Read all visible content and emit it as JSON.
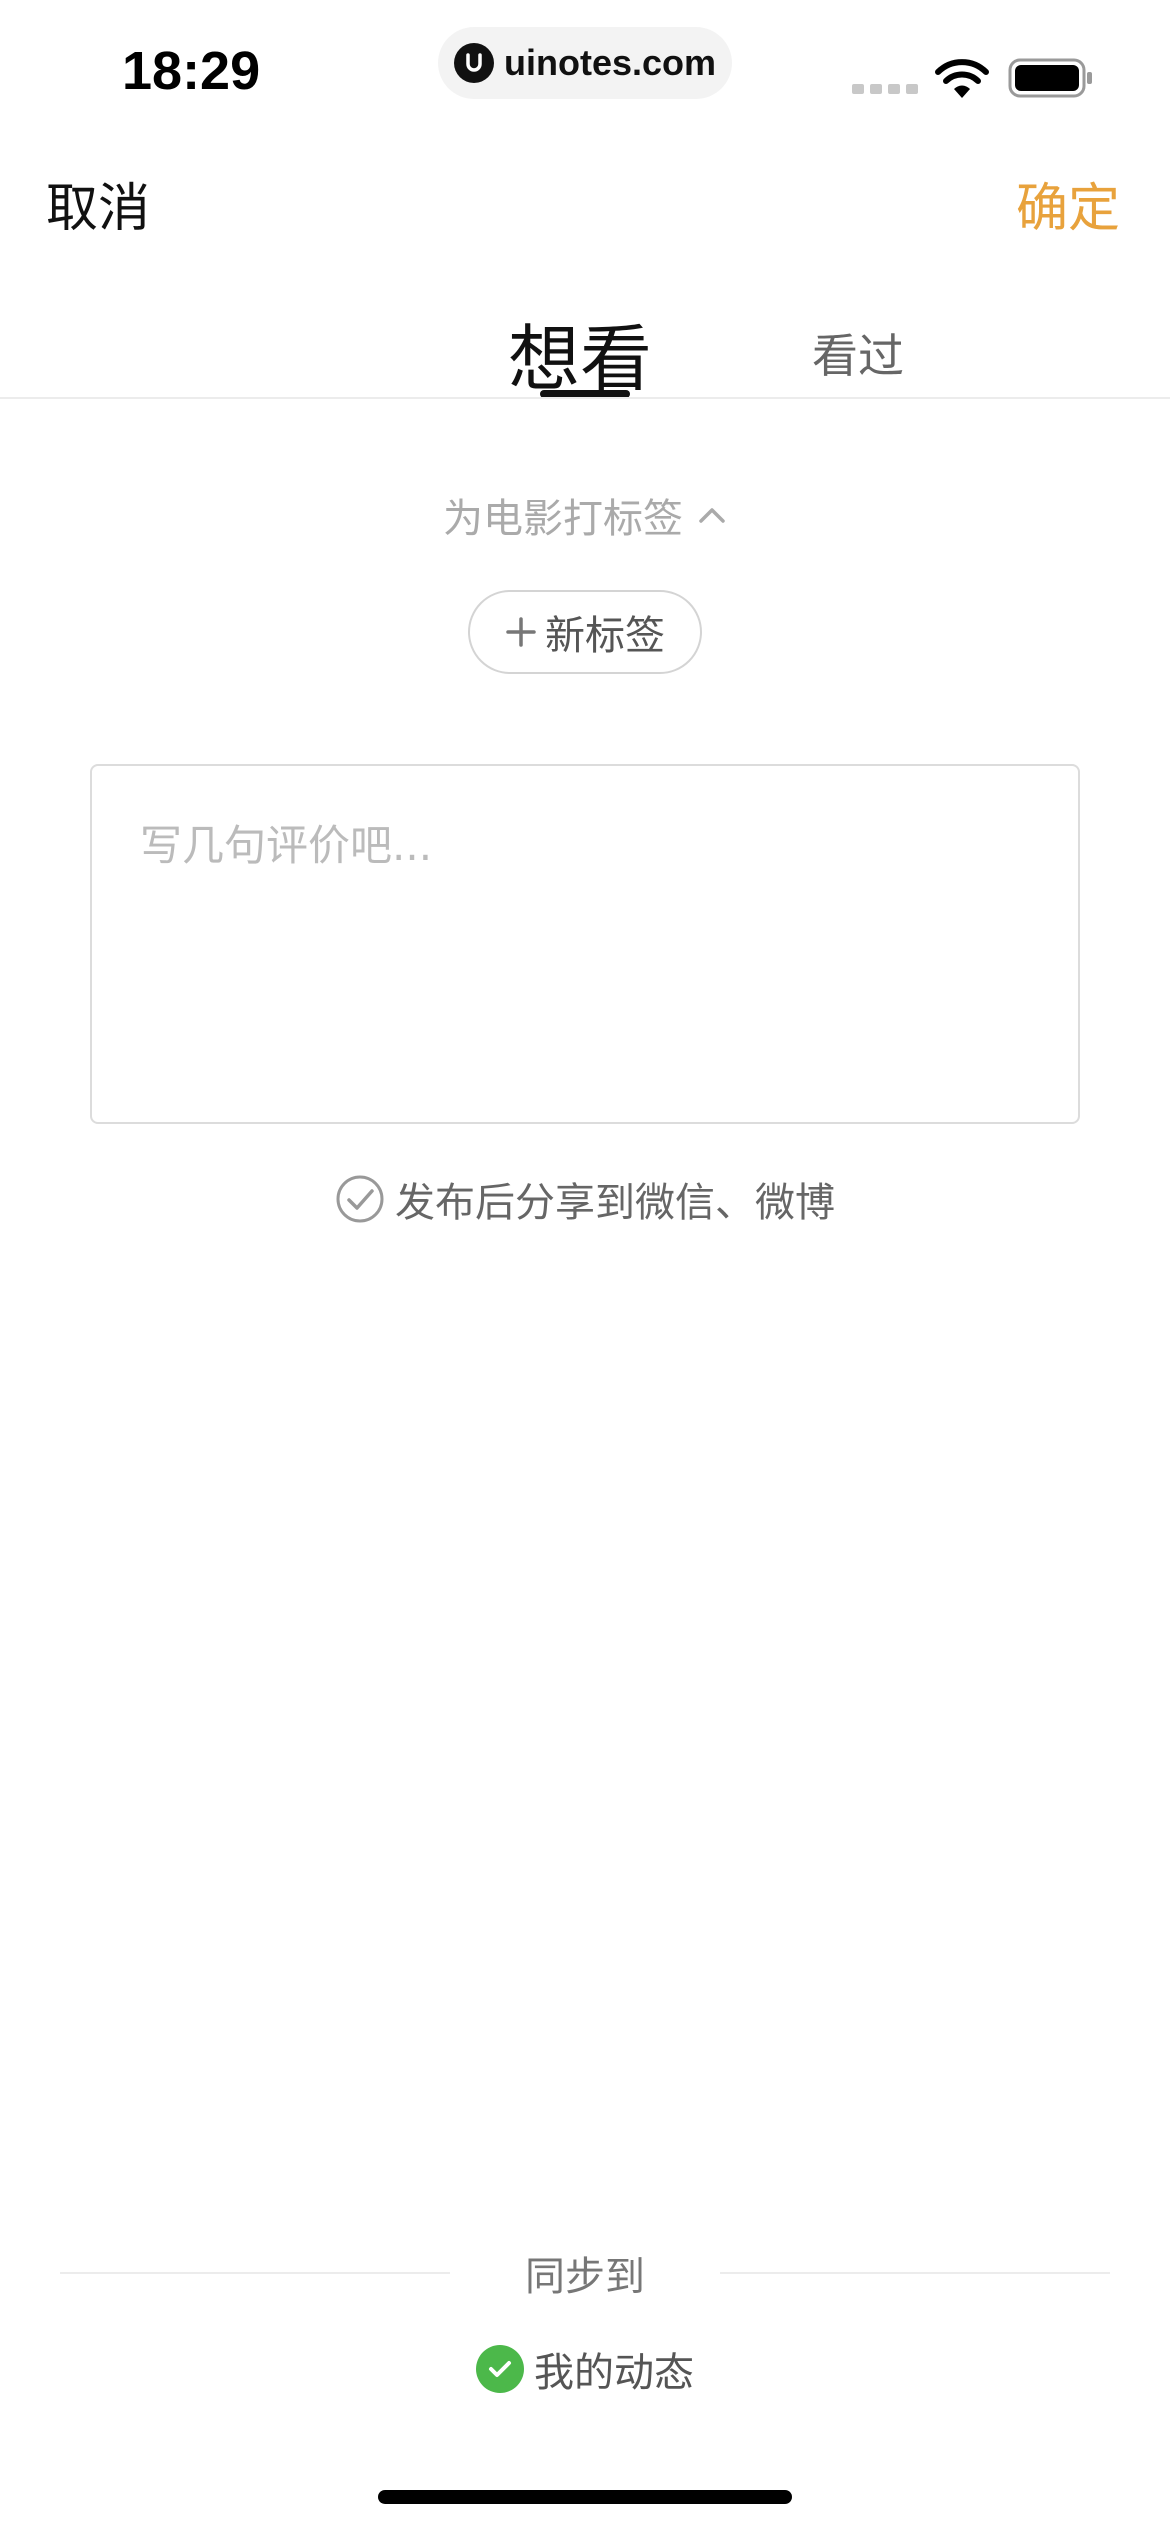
{
  "status_bar": {
    "time": "18:29",
    "url": "uinotes.com"
  },
  "header": {
    "cancel_label": "取消",
    "confirm_label": "确定",
    "confirm_color": "#e8a23c"
  },
  "tabs": [
    {
      "label": "想看",
      "active": true
    },
    {
      "label": "看过",
      "active": false
    }
  ],
  "tags": {
    "toggle_label": "为电影打标签",
    "new_tag_label": "新标签"
  },
  "review": {
    "value": "",
    "placeholder": "写几句评价吧..."
  },
  "share": {
    "label": "发布后分享到微信、微博"
  },
  "sync": {
    "title": "同步到",
    "option_label": "我的动态",
    "option_checked": true,
    "check_color": "#4cb84a"
  }
}
